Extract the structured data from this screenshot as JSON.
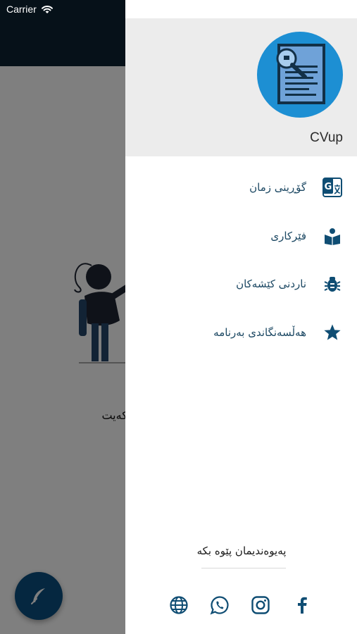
{
  "status_bar": {
    "carrier": "Carrier"
  },
  "app": {
    "name": "CVup"
  },
  "background": {
    "message": "ل دروست بکەیت"
  },
  "menu": {
    "items": [
      {
        "label": "گۆڕینی زمان",
        "icon": "translate-icon"
      },
      {
        "label": "فێرکاری",
        "icon": "tutorial-book-icon"
      },
      {
        "label": "ناردنی کێشەکان",
        "icon": "bug-icon"
      },
      {
        "label": "هەڵسەنگاندی بەرنامە",
        "icon": "star-icon"
      }
    ]
  },
  "contact": {
    "title": "پەیوەندیمان پێوە بکە",
    "links": [
      "globe-icon",
      "whatsapp-icon",
      "instagram-icon",
      "facebook-icon"
    ]
  },
  "colors": {
    "primary": "#0b4f80",
    "accent": "#1d8fd3",
    "header_dark": "#0d2233",
    "menu_text": "#1c4863"
  }
}
